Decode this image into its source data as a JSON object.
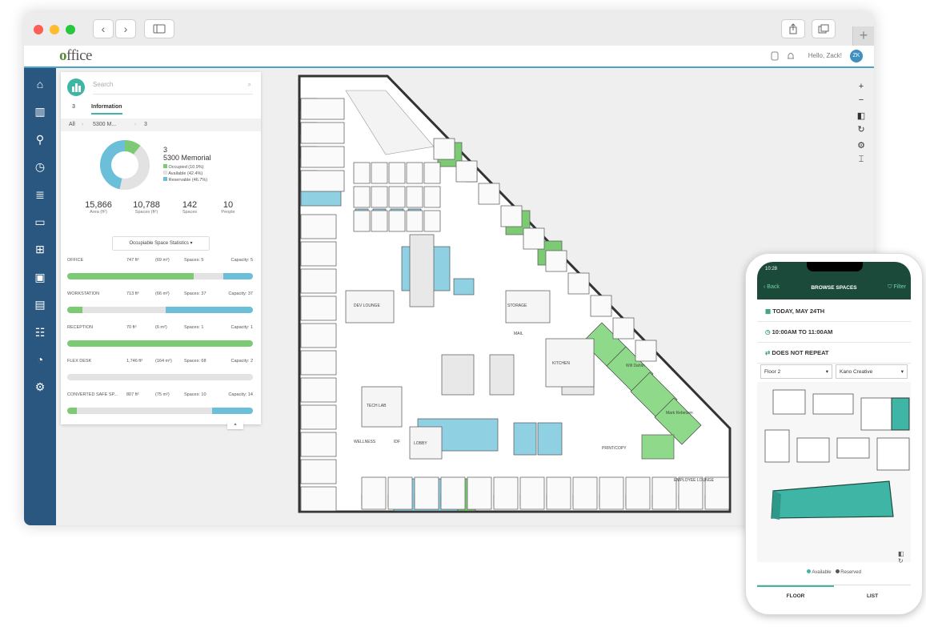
{
  "app": {
    "logo_prefix": "o",
    "logo_rest": "ffice",
    "greeting": "Hello, Zack!",
    "avatar": "ZK"
  },
  "sidebar": {
    "icons": [
      "home-icon",
      "buildings-icon",
      "person-icon",
      "clock-icon",
      "stack-icon",
      "monitor-icon",
      "org-chart-icon",
      "box-icon",
      "id-card-icon",
      "people-icon",
      "pie-chart-icon",
      "gear-icon"
    ]
  },
  "panel": {
    "search_placeholder": "Search",
    "tab_count": "3",
    "tab_info": "Information",
    "breadcrumb": [
      "All",
      "5300 M...",
      "3"
    ],
    "floor": "3",
    "building": "5300 Memorial",
    "legend": [
      "Occupied (10.9%)",
      "Available (42.4%)",
      "Reservable (46.7%)"
    ],
    "stats": [
      {
        "value": "15,866",
        "label": "Area (ft²)"
      },
      {
        "value": "10,788",
        "label": "Spaces (ft²)"
      },
      {
        "value": "142",
        "label": "Spaces"
      },
      {
        "value": "10",
        "label": "People"
      }
    ],
    "dropdown": "Occupiable Space Statistics ▾",
    "rows": [
      {
        "name": "OFFICE",
        "area": "747 ft²",
        "m": "(69 m²)",
        "spaces": "Spaces: 5",
        "cap": "Capacity: 5",
        "green": 0.68,
        "gray": 0.16,
        "blue": 0.16
      },
      {
        "name": "WORKSTATION",
        "area": "713 ft²",
        "m": "(66 m²)",
        "spaces": "Spaces: 37",
        "cap": "Capacity: 37",
        "green": 0.08,
        "gray": 0.45,
        "blue": 0.47
      },
      {
        "name": "RECEPTION",
        "area": "70 ft²",
        "m": "(6 m²)",
        "spaces": "Spaces: 1",
        "cap": "Capacity: 1",
        "green": 1.0,
        "gray": 0.0,
        "blue": 0.0
      },
      {
        "name": "FLEX DESK",
        "area": "1,746 ft²",
        "m": "(164 m²)",
        "spaces": "Spaces: 68",
        "cap": "Capacity: 2",
        "green": 0.0,
        "gray": 1.0,
        "blue": 0.0
      },
      {
        "name": "CONVERTED SAFE SP...",
        "area": "807 ft²",
        "m": "(75 m²)",
        "spaces": "Spaces: 10",
        "cap": "Capacity: 14",
        "green": 0.05,
        "gray": 0.73,
        "blue": 0.22
      }
    ]
  },
  "floorplan": {
    "rooms": [
      "DEV LOUNGE",
      "STORAGE",
      "KITCHEN",
      "MAIL",
      "TECH LAB",
      "WELLNESS",
      "LOBBY",
      "IDF",
      "PRINT/COPY",
      "EMPLOYEE LOUNGE",
      "Mark Rebelsen",
      "Will Dahlin"
    ]
  },
  "phone": {
    "time": "10:28",
    "back": "Back",
    "title": "BROWSE SPACES",
    "filter": "Filter",
    "date": "TODAY, MAY 24TH",
    "time_range": "10:00AM TO 11:00AM",
    "repeat": "DOES NOT REPEAT",
    "floor_select": "Floor 2",
    "company_select": "Kano Creative",
    "legend_available": "Available",
    "legend_reserved": "Reserved",
    "tab_floor": "FLOOR",
    "tab_list": "LIST"
  },
  "colors": {
    "green": "#7ccb74",
    "blue": "#6bbfd8",
    "sidebar": "#2a5780"
  }
}
